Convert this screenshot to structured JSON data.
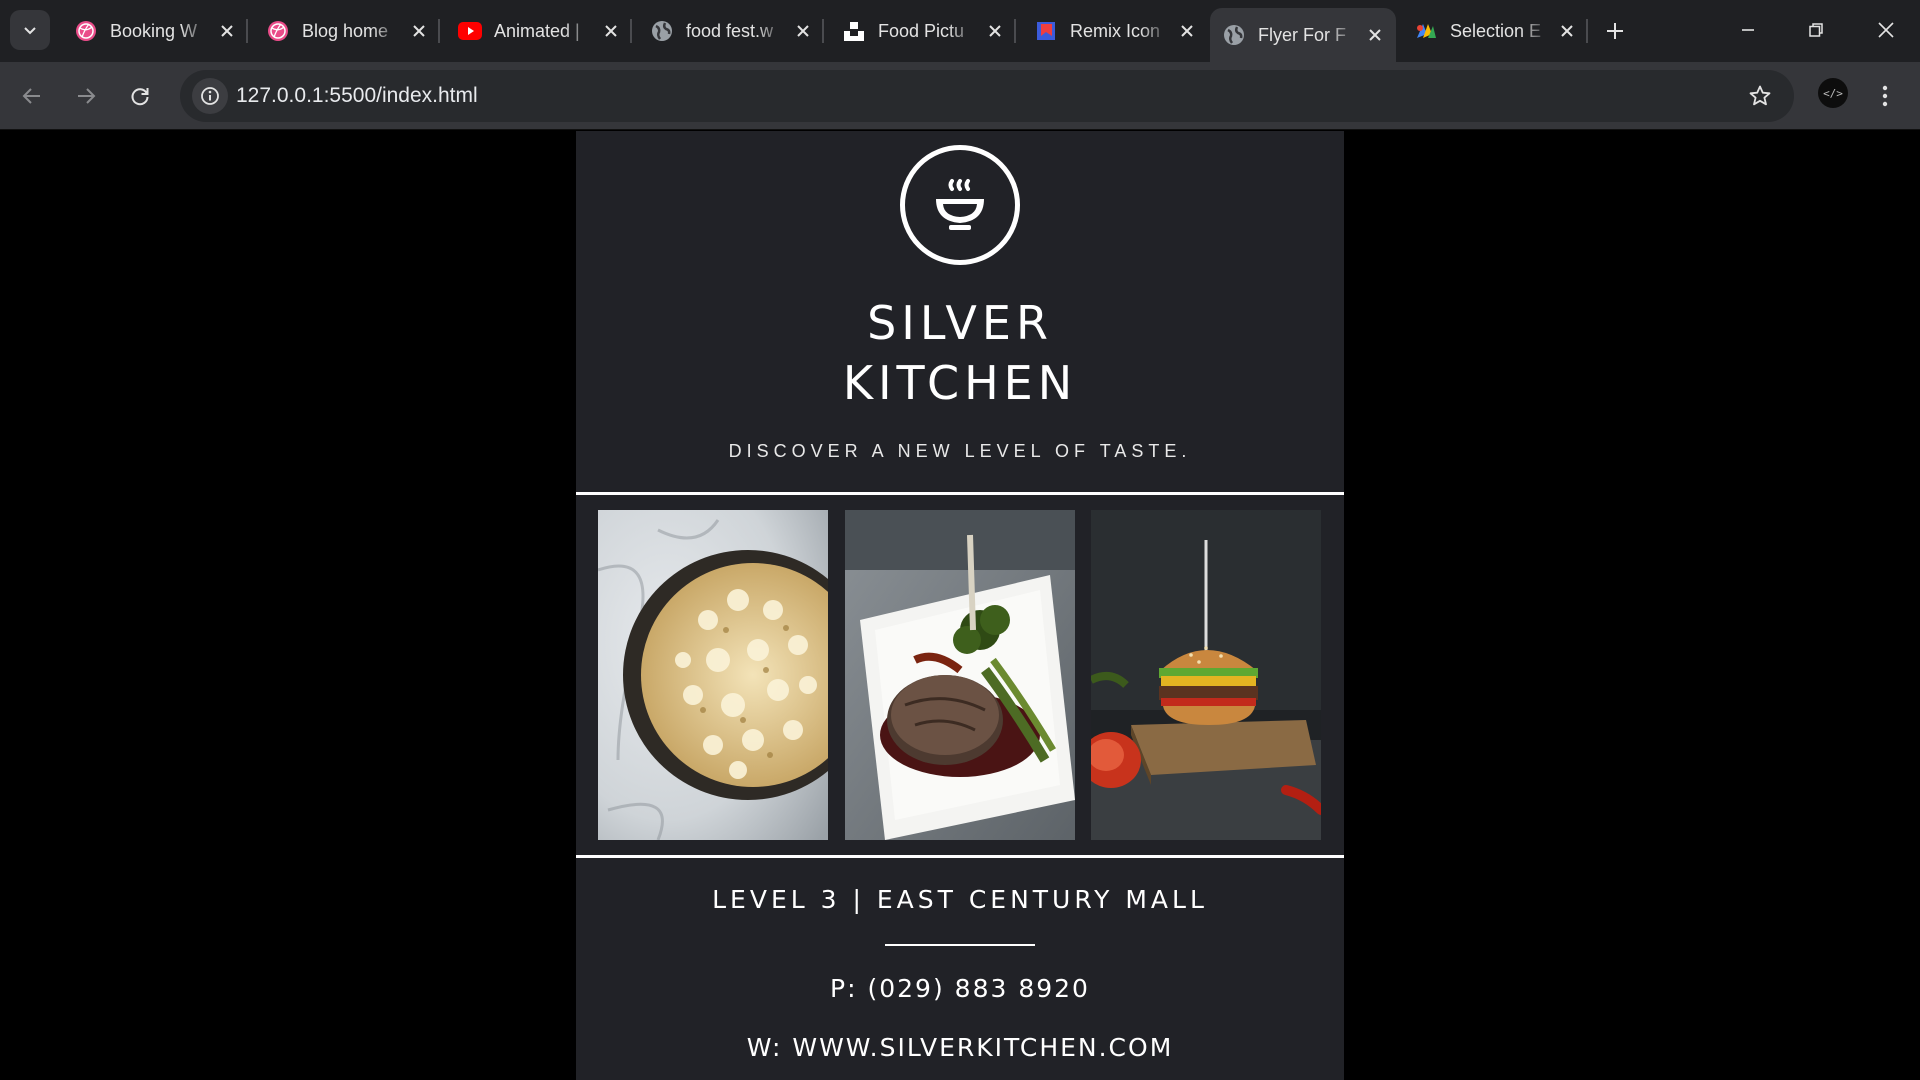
{
  "browser": {
    "tabs": [
      {
        "title": "Booking W",
        "icon": "dribbble-icon",
        "active": false
      },
      {
        "title": "Blog home",
        "icon": "dribbble-icon",
        "active": false
      },
      {
        "title": "Animated |",
        "icon": "youtube-icon",
        "active": false
      },
      {
        "title": "food fest.w",
        "icon": "globe-icon",
        "active": false
      },
      {
        "title": "Food Pictu",
        "icon": "unsplash-icon",
        "active": false
      },
      {
        "title": "Remix Icon",
        "icon": "remix-icon",
        "active": false
      },
      {
        "title": "Flyer For F",
        "icon": "globe-icon",
        "active": true
      },
      {
        "title": "Selection E",
        "icon": "selection-icon",
        "active": false
      }
    ],
    "url": "127.0.0.1:5500/index.html",
    "colors": {
      "chrome_dark": "#1f2023",
      "chrome_tab": "#35363a",
      "omnibox": "#282a2d"
    }
  },
  "flyer": {
    "logo_icon": "steaming-bowl-icon",
    "brand_line1": "SILVER",
    "brand_line2": "KITCHEN",
    "tagline": "DISCOVER A NEW LEVEL OF TASTE.",
    "photos": [
      "popcorn-bowl-photo",
      "steak-plate-photo",
      "burger-board-photo"
    ],
    "address": "LEVEL 3 | EAST CENTURY MALL",
    "phone": "P: (029) 883 8920",
    "website": "W: WWW.SILVERKITCHEN.COM",
    "colors": {
      "background": "#212227",
      "text": "#ffffff"
    }
  }
}
